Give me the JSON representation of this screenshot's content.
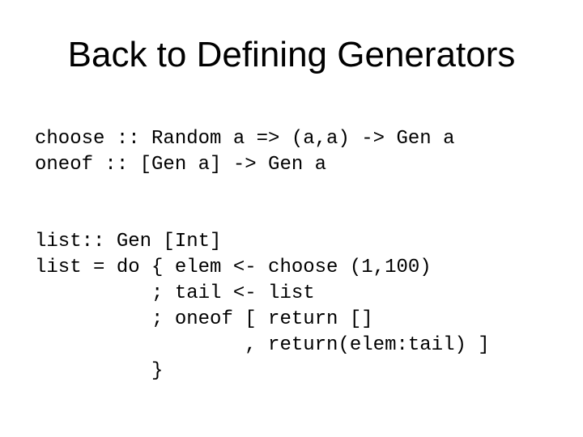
{
  "slide": {
    "title": "Back to Defining Generators",
    "signatures": [
      "choose :: Random a => (a,a) -> Gen a",
      "oneof :: [Gen a] -> Gen a"
    ],
    "list_code": [
      "list:: Gen [Int]",
      "list = do { elem <- choose (1,100)",
      "          ; tail <- list",
      "          ; oneof [ return []",
      "                  , return(elem:tail) ]",
      "          }"
    ]
  }
}
